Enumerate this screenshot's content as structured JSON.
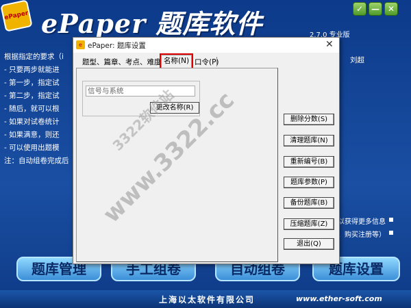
{
  "app": {
    "logo_text": "ePaper",
    "title": "ePaper 题库软件",
    "version": "2.7.0 专业版",
    "author": "刘超",
    "window_controls": {
      "check": "✓",
      "minimize": "—",
      "close": "✕"
    }
  },
  "intro_lines": [
    "根据指定的要求（i",
    "-  只要两步就能进",
    "-  第一步，指定试",
    "-  第二步，指定试",
    "-  随后，就可以根",
    "-  如果对试卷统计",
    "-  如果满意，则还",
    "-  可以使用出题模",
    "注：自动组卷完成后"
  ],
  "side_notes": [
    "以获得更多信息",
    "、购买注册等）"
  ],
  "nav": {
    "bank": "题库管理",
    "manual": "手工组卷",
    "auto": "自动组卷",
    "settings": "题库设置"
  },
  "footer": {
    "company": "上海以太软件有限公司",
    "url": "www.ether-soft.com"
  },
  "dialog": {
    "title": "ePaper: 题库设置",
    "close": "✕",
    "tabs": {
      "types": "题型、篇章、考点、难度(A)",
      "name": "名称(N)",
      "password": "口令(P)"
    },
    "name_input": {
      "value": "信号与系统"
    },
    "rename_button": "更改名称(R)",
    "buttons": {
      "delete_scores": "删除分数(S)",
      "clean_bank": "清理题库(N)",
      "renumber": "重新编号(B)",
      "bank_params": "题库参数(P)",
      "backup": "备份题库(B)",
      "compress": "压缩题库(Z)",
      "exit": "退出(Q)"
    }
  },
  "watermarks": {
    "main": "www.3322.cc",
    "secondary": "3322软件站"
  }
}
